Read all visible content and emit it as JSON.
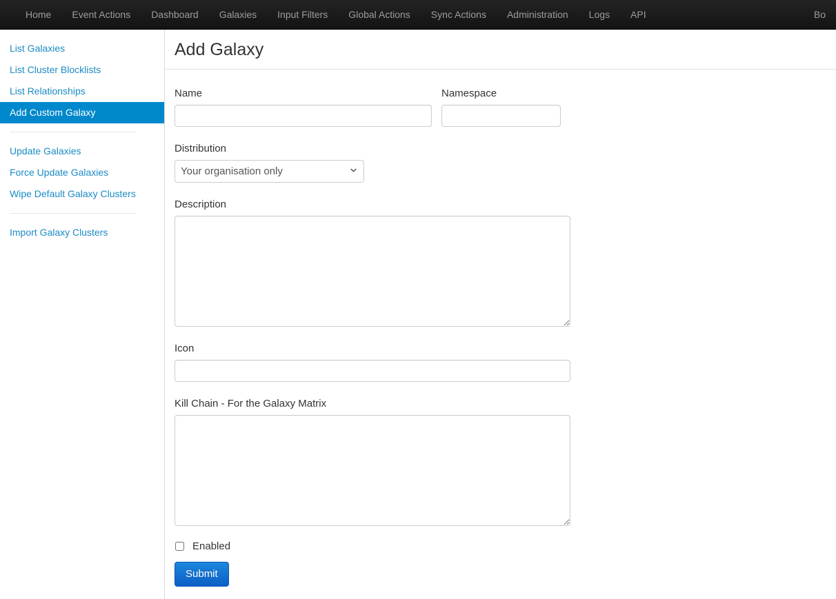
{
  "navbar": {
    "items": [
      {
        "label": "Home"
      },
      {
        "label": "Event Actions"
      },
      {
        "label": "Dashboard"
      },
      {
        "label": "Galaxies"
      },
      {
        "label": "Input Filters"
      },
      {
        "label": "Global Actions"
      },
      {
        "label": "Sync Actions"
      },
      {
        "label": "Administration"
      },
      {
        "label": "Logs"
      },
      {
        "label": "API"
      }
    ],
    "right_item": {
      "label": "Bo"
    },
    "background_color": "#1b1b1b",
    "text_color": "#9d9d9d"
  },
  "sidebar": {
    "groups": [
      {
        "items": [
          {
            "label": "List Galaxies",
            "active": false
          },
          {
            "label": "List Cluster Blocklists",
            "active": false
          },
          {
            "label": "List Relationships",
            "active": false
          },
          {
            "label": "Add Custom Galaxy",
            "active": true
          }
        ]
      },
      {
        "items": [
          {
            "label": "Update Galaxies",
            "active": false
          },
          {
            "label": "Force Update Galaxies",
            "active": false
          },
          {
            "label": "Wipe Default Galaxy Clusters",
            "active": false
          }
        ]
      },
      {
        "items": [
          {
            "label": "Import Galaxy Clusters",
            "active": false
          }
        ]
      }
    ],
    "link_color": "#1a8bc4",
    "active_background": "#0088cc",
    "active_text_color": "#ffffff"
  },
  "main": {
    "page_title": "Add Galaxy",
    "form": {
      "name": {
        "label": "Name",
        "value": "",
        "placeholder": ""
      },
      "namespace": {
        "label": "Namespace",
        "value": "",
        "placeholder": ""
      },
      "distribution": {
        "label": "Distribution",
        "selected": "Your organisation only",
        "options": [
          "Your organisation only"
        ]
      },
      "description": {
        "label": "Description",
        "value": "",
        "placeholder": ""
      },
      "icon": {
        "label": "Icon",
        "value": "",
        "placeholder": ""
      },
      "kill_chain": {
        "label": "Kill Chain - For the Galaxy Matrix",
        "value": "",
        "placeholder": ""
      },
      "enabled": {
        "label": "Enabled",
        "checked": false
      },
      "submit": {
        "label": "Submit",
        "color": "#0b5fc6"
      }
    }
  }
}
